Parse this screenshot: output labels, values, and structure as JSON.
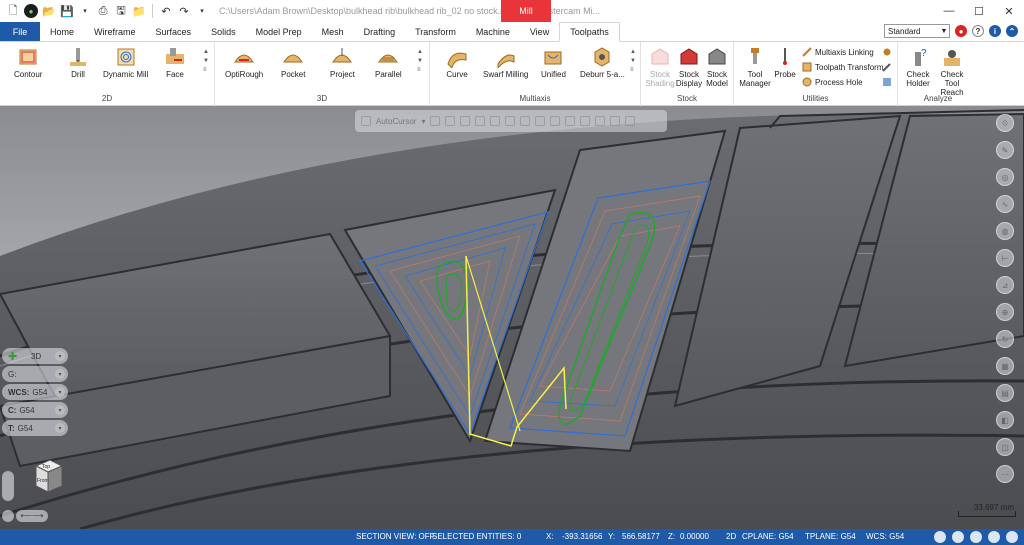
{
  "titlebar": {
    "path": "C:\\Users\\Adam Brown\\Desktop\\bulkhead rib\\bulkhead rib_02 no stock.mcam* - Mastercam Mi...",
    "context_tab": "Mill"
  },
  "tabs": [
    "Home",
    "Wireframe",
    "Surfaces",
    "Solids",
    "Model Prep",
    "Mesh",
    "Drafting",
    "Transform",
    "Machine",
    "View",
    "Toolpaths"
  ],
  "file_tab": "File",
  "active_tab": "Toolpaths",
  "config_select": "Standard",
  "ribbon": {
    "g2d": {
      "label": "2D",
      "buttons": [
        "Contour",
        "Drill",
        "Dynamic Mill",
        "Face"
      ]
    },
    "g3d": {
      "label": "3D",
      "buttons": [
        "OptiRough",
        "Pocket",
        "Project",
        "Parallel"
      ]
    },
    "multiaxis": {
      "label": "Multiaxis",
      "buttons": [
        "Curve",
        "Swarf Milling",
        "Unified",
        "Deburr 5-a..."
      ]
    },
    "stock": {
      "label": "Stock",
      "buttons": [
        "Stock Shading",
        "Stock Display",
        "Stock Model"
      ]
    },
    "utilities": {
      "label": "Utilities",
      "buttons": [
        "Tool Manager",
        "Probe"
      ],
      "small": [
        "Multiaxis Linking",
        "Toolpath Transform",
        "Process Hole"
      ]
    },
    "analyze": {
      "label": "Analyze",
      "buttons": [
        "Check Holder",
        "Check Tool Reach"
      ]
    }
  },
  "floatbar": {
    "autocursor": "AutoCursor"
  },
  "leftpanel": {
    "view": "3D",
    "g_label": "G:",
    "wcs_label": "WCS:",
    "wcs_value": "G54",
    "c_label": "C:",
    "c_value": "G54",
    "t_label": "T:",
    "t_value": "G54"
  },
  "cube": {
    "top": "Top",
    "front": "Front"
  },
  "scale": "33.697 mm",
  "status": {
    "section_view": "SECTION VIEW: OFF",
    "selected": "SELECTED ENTITIES: 0",
    "x_label": "X:",
    "x": "-393.31656",
    "y_label": "Y:",
    "y": "566.58177",
    "z_label": "Z:",
    "z": "0.00000",
    "mode": "2D",
    "cplane": "CPLANE: G54",
    "tplane": "TPLANE: G54",
    "wcs": "WCS: G54"
  },
  "colors": {
    "accent": "#1e5aa8",
    "context": "#e9343a",
    "toolpath_blue": "#2f6fd6",
    "toolpath_green": "#1fa82a",
    "rapid_yellow": "#f5f04a"
  }
}
